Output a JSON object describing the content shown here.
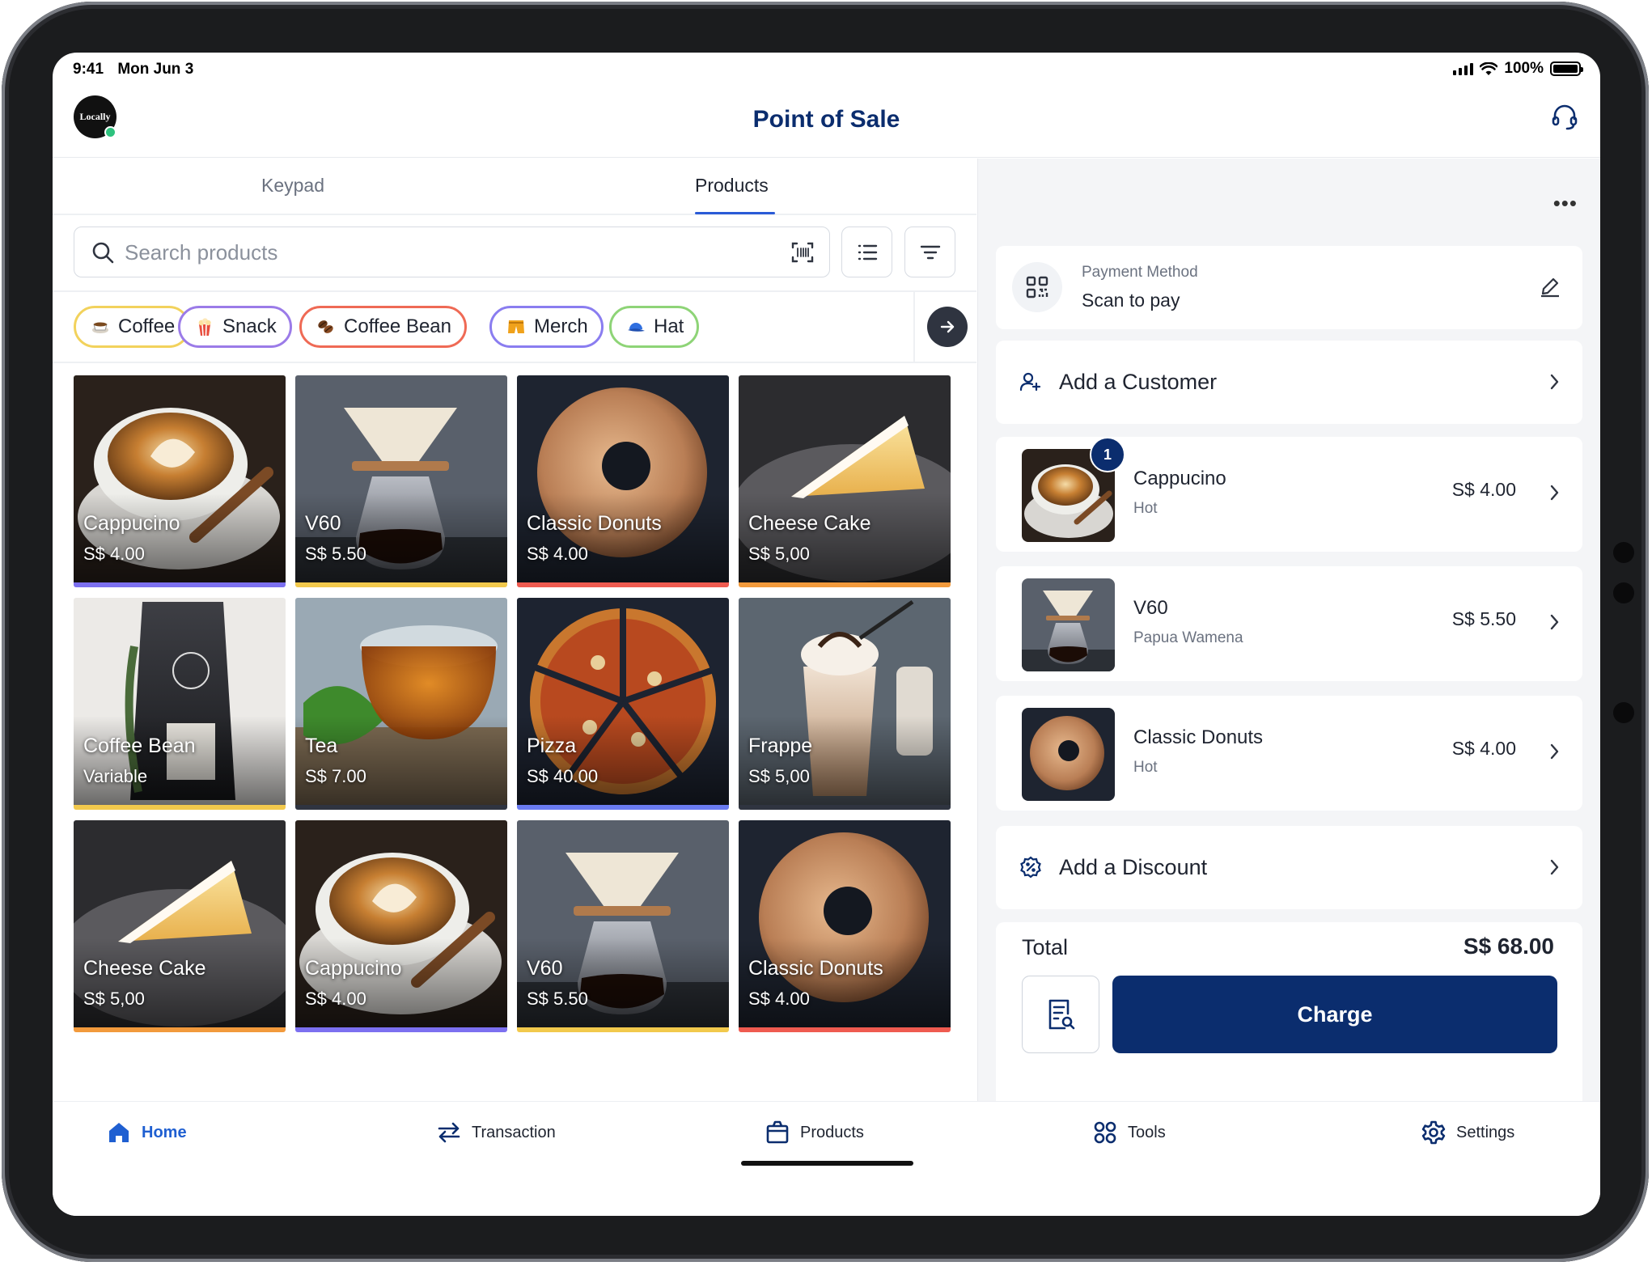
{
  "status_bar": {
    "time": "9:41",
    "date": "Mon Jun 3",
    "battery": "100%"
  },
  "header": {
    "logo_text": "Locally",
    "title": "Point of Sale"
  },
  "tabs": [
    {
      "label": "Keypad"
    },
    {
      "label": "Products"
    }
  ],
  "search": {
    "placeholder": "Search products"
  },
  "categories": [
    {
      "label": "Coffee",
      "color": "#f2d25c"
    },
    {
      "label": "Snack",
      "color": "#9b7be8"
    },
    {
      "label": "Coffee Bean",
      "color": "#ef6a55"
    },
    {
      "label": "Merch",
      "color": "#8a7df0"
    },
    {
      "label": "Hat",
      "color": "#8ed477"
    }
  ],
  "products": [
    {
      "name": "Cappucino",
      "price": "S$ 4.00",
      "color": "#7c70f0"
    },
    {
      "name": "V60",
      "price": "S$ 5.50",
      "color": "#f2c94c"
    },
    {
      "name": "Classic Donuts",
      "price": "S$ 4.00",
      "color": "#ef5b50"
    },
    {
      "name": "Cheese Cake",
      "price": "S$ 5,00",
      "color": "#f29a3c"
    },
    {
      "name": "Coffee Bean",
      "price": "Variable",
      "color": "#f2c94c"
    },
    {
      "name": "Tea",
      "price": "S$ 7.00",
      "color": "#2f3440"
    },
    {
      "name": "Pizza",
      "price": "S$ 40.00",
      "color": "#6a7bf0"
    },
    {
      "name": "Frappe",
      "price": "S$ 5,00",
      "color": "#2f3440"
    },
    {
      "name": "Cheese Cake",
      "price": "S$ 5,00",
      "color": "#f29a3c"
    },
    {
      "name": "Cappucino",
      "price": "S$ 4.00",
      "color": "#7c70f0"
    },
    {
      "name": "V60",
      "price": "S$ 5.50",
      "color": "#f2c94c"
    },
    {
      "name": "Classic Donuts",
      "price": "S$ 4.00",
      "color": "#ef5b50"
    }
  ],
  "payment": {
    "label": "Payment Method",
    "value": "Scan to pay"
  },
  "customer": {
    "label": "Add a Customer"
  },
  "cart": [
    {
      "name": "Cappucino",
      "variant": "Hot",
      "price": "S$ 4.00",
      "qty": "1"
    },
    {
      "name": "V60",
      "variant": "Papua Wamena",
      "price": "S$ 5.50"
    },
    {
      "name": "Classic Donuts",
      "variant": "Hot",
      "price": "S$ 4.00"
    }
  ],
  "discount": {
    "label": "Add a Discount"
  },
  "total": {
    "label": "Total",
    "value": "S$ 68.00"
  },
  "charge": {
    "label": "Charge"
  },
  "nav": [
    {
      "label": "Home",
      "icon": "home-icon"
    },
    {
      "label": "Transaction",
      "icon": "swap-icon"
    },
    {
      "label": "Products",
      "icon": "box-icon"
    },
    {
      "label": "Tools",
      "icon": "grid-icon"
    },
    {
      "label": "Settings",
      "icon": "gear-icon"
    }
  ],
  "colors": {
    "brand": "#0b2d6e",
    "accent": "#2a5bd7",
    "nav_active": "#1f5fd1"
  }
}
